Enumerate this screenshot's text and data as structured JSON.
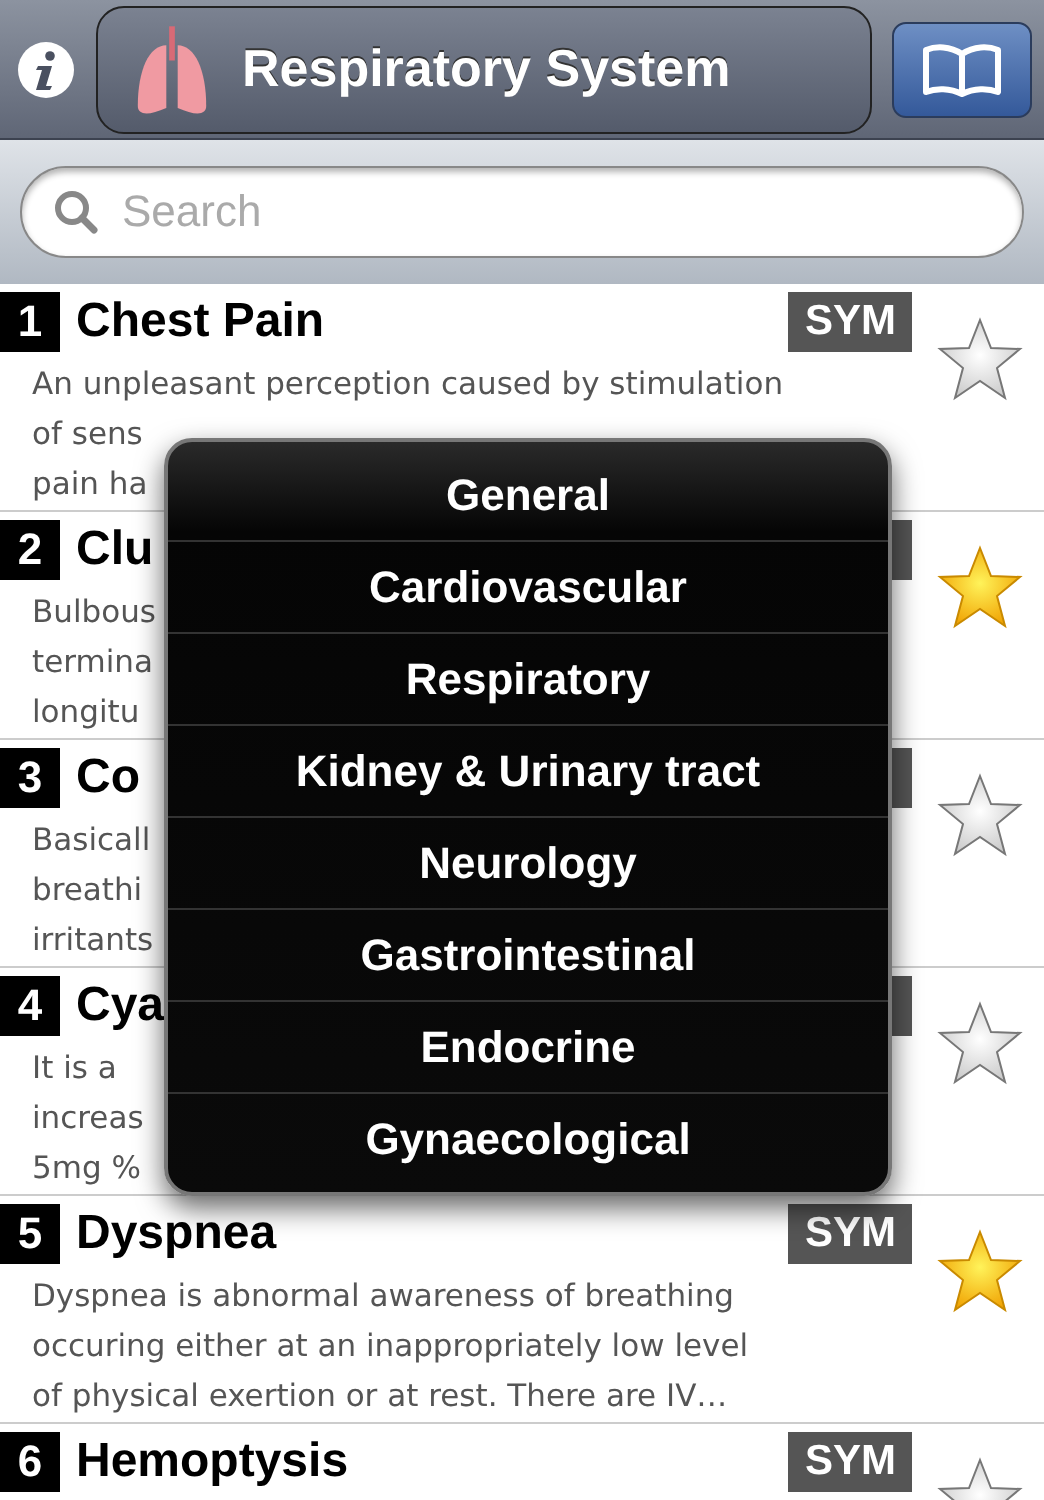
{
  "nav": {
    "title": "Respiratory System"
  },
  "search": {
    "placeholder": "Search"
  },
  "rows": [
    {
      "number": "1",
      "title": "Chest Pain",
      "badge": "SYM",
      "starred": false,
      "lines": [
        "An unpleasant perception caused by stimulation",
        "of sens",
        "pain ha"
      ]
    },
    {
      "number": "2",
      "title": "Clu",
      "badge_covered": true,
      "starred": true,
      "lines": [
        "Bulbous",
        "termina",
        "longitu"
      ]
    },
    {
      "number": "3",
      "title": "Co",
      "badge_covered": true,
      "starred": false,
      "lines": [
        "Basicall",
        "breathi",
        "irritants"
      ]
    },
    {
      "number": "4",
      "title": "Cya",
      "badge_covered": true,
      "starred": false,
      "lines": [
        "It is a",
        "increas",
        "5mg %"
      ]
    },
    {
      "number": "5",
      "title": "Dyspnea",
      "badge": "SYM",
      "starred": true,
      "lines": [
        "Dyspnea is abnormal awareness of breathing",
        "occuring either at an inappropriately low level",
        "of physical exertion or at rest. There are IV…"
      ]
    },
    {
      "number": "6",
      "title": "Hemoptysis",
      "badge": "SYM",
      "starred": false,
      "lines": []
    }
  ],
  "menu": [
    "General",
    "Cardiovascular",
    "Respiratory",
    "Kidney & Urinary tract",
    "Neurology",
    "Gastrointestinal",
    "Endocrine",
    "Gynaecological"
  ]
}
